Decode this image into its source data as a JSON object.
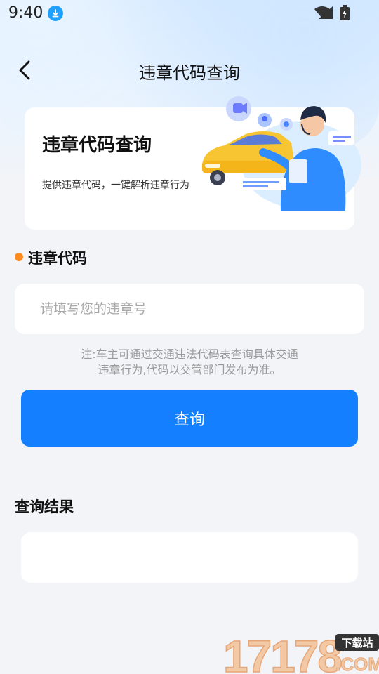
{
  "status_bar": {
    "time": "9:40"
  },
  "header": {
    "title": "违章代码查询"
  },
  "banner": {
    "title": "违章代码查询",
    "subtitle": "提供违章代码，一键解析违章行为"
  },
  "form": {
    "section_label": "违章代码",
    "input_placeholder": "请填写您的违章号",
    "input_value": "",
    "note_line1": "注:车主可通过交通违法代码表查询具体交通",
    "note_line2": "违章行为,代码以交管部门发布为准。",
    "submit_label": "查询"
  },
  "result": {
    "label": "查询结果",
    "value": ""
  },
  "watermark": {
    "big": "17178",
    "tag": "下载站",
    "domain": ".COM"
  },
  "icons": [
    "download-icon",
    "wifi-icon",
    "cell-signal-icon",
    "battery-icon",
    "back-arrow-icon"
  ],
  "colors": {
    "accent": "#1480ff",
    "dot": "#ff8a1e",
    "background": "#f2f4f8"
  }
}
